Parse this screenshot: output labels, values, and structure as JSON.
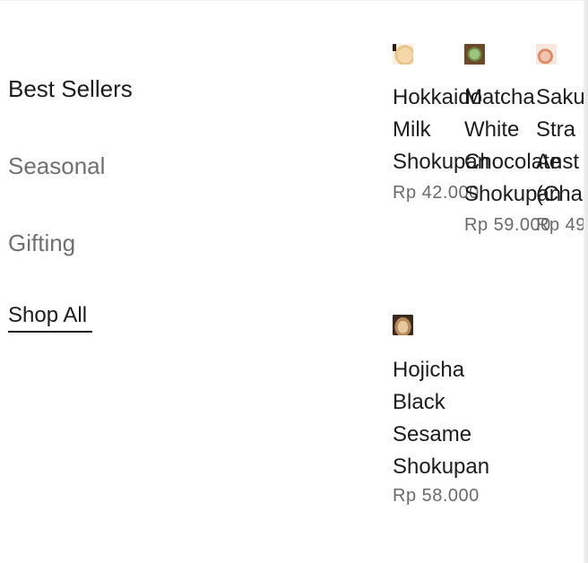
{
  "nav": {
    "items": [
      {
        "label": "Best Sellers"
      },
      {
        "label": "Seasonal"
      },
      {
        "label": "Gifting"
      },
      {
        "label": "Shop All"
      }
    ]
  },
  "products": [
    {
      "name_lines": [
        "Hokkaido",
        "Milk",
        "Shokupan"
      ],
      "price": "Rp 42.000",
      "image": "hokkaido-milk-shokupan-thumbnail"
    },
    {
      "name_lines": [
        "Matcha",
        "White",
        "Chocolate",
        "Shokupan"
      ],
      "price": "Rp 59.000",
      "image": "matcha-white-chocolate-shokupan-thumbnail"
    },
    {
      "name_lines": [
        "Saku",
        "Stra",
        "Anst",
        "(Chas"
      ],
      "price": "Rp 49",
      "image": "sakura-strawberry-thumbnail"
    },
    {
      "name_lines": [
        "Hojicha",
        "Black",
        "Sesame",
        "Shokupan"
      ],
      "price": "Rp 58.000",
      "image": "hojicha-black-sesame-shokupan-thumbnail"
    }
  ]
}
